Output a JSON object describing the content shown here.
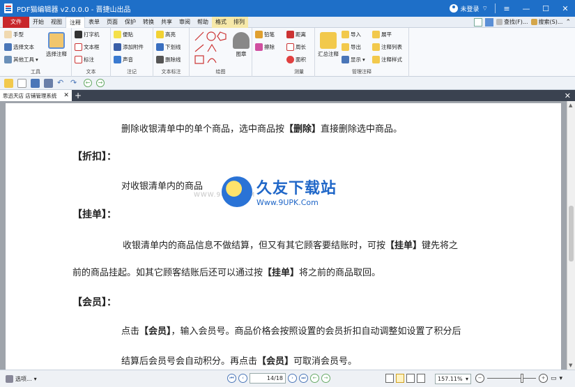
{
  "titlebar": {
    "title": "PDF猫编辑器 v2.0.0.0 - 晋捷山出品",
    "login": "未登录",
    "colors": {
      "bar": "#1e6fc8"
    }
  },
  "menu": {
    "tabs": [
      "文件",
      "开始",
      "视图",
      "注释",
      "表单",
      "页面",
      "保护",
      "转换",
      "共享",
      "审阅",
      "帮助",
      "格式",
      "排列"
    ],
    "active_tab": "注释",
    "find_label": "查找(F)...",
    "search_label": "搜索(S)..."
  },
  "ribbon": {
    "tools": {
      "hand": "手型",
      "select_text": "选择文本",
      "other_tools": "其他工具",
      "select_annot": "选择注释",
      "label": "工具"
    },
    "text": {
      "typewriter": "打字机",
      "textbox": "文本框",
      "callout": "标注",
      "label": "文本"
    },
    "annot": {
      "note": "便贴",
      "attach": "添加附件",
      "sound": "声音",
      "label": "注记"
    },
    "textmark": {
      "highlight": "高亮",
      "underline": "下划线",
      "strike": "删除线",
      "label": "文本标注"
    },
    "draw": {
      "label": "绘图"
    },
    "stamp": {
      "stamp": "图章",
      "pencil": "铅笔",
      "eraser": "擦除"
    },
    "measure": {
      "distance": "距离",
      "perimeter": "周长",
      "area": "面积",
      "label": "测量"
    },
    "manage": {
      "summary": "汇总注释",
      "import": "导入",
      "export": "导出",
      "show": "显示",
      "expand": "展平",
      "list": "注释列表",
      "style": "注释样式",
      "label": "管理注释"
    }
  },
  "doc_tab": {
    "name": "思迅天店 店铺管理系统"
  },
  "document": {
    "l1_pre": "删除收银清单中的单个商品，选中商品按",
    "l1_bold": "【删除】",
    "l1_post": "直接删除选中商品。",
    "h1": "【折扣】：",
    "l2": "对收银清单内的商品",
    "h2": "【挂单】：",
    "l3_pre": "收银清单内的商品信息不做结算，但又有其它顾客要结账时，可按",
    "l3_bold": "【挂单】",
    "l3_post": "键先将之",
    "l4_pre": "前的商品挂起。如其它顾客结账后还可以通过按",
    "l4_bold": "【挂单】",
    "l4_post": "将之前的商品取回。",
    "h3": "【会员】：",
    "l5_pre": "点击",
    "l5_bold": "【会员】",
    "l5_post": "，输入会员号。商品价格会按照设置的会员折扣自动调整如设置了积分后",
    "l6_pre": "结算后会员号会自动积分。再点击",
    "l6_bold": "【会员】",
    "l6_post": "可取消会员号。"
  },
  "watermark": {
    "cn": "久友下载站",
    "en": "Www.9UPK.Com",
    "faint": "WWW.9UPK.COM"
  },
  "status": {
    "options": "选项...",
    "page_current": "14",
    "page_total": "18",
    "zoom": "157.11%"
  }
}
